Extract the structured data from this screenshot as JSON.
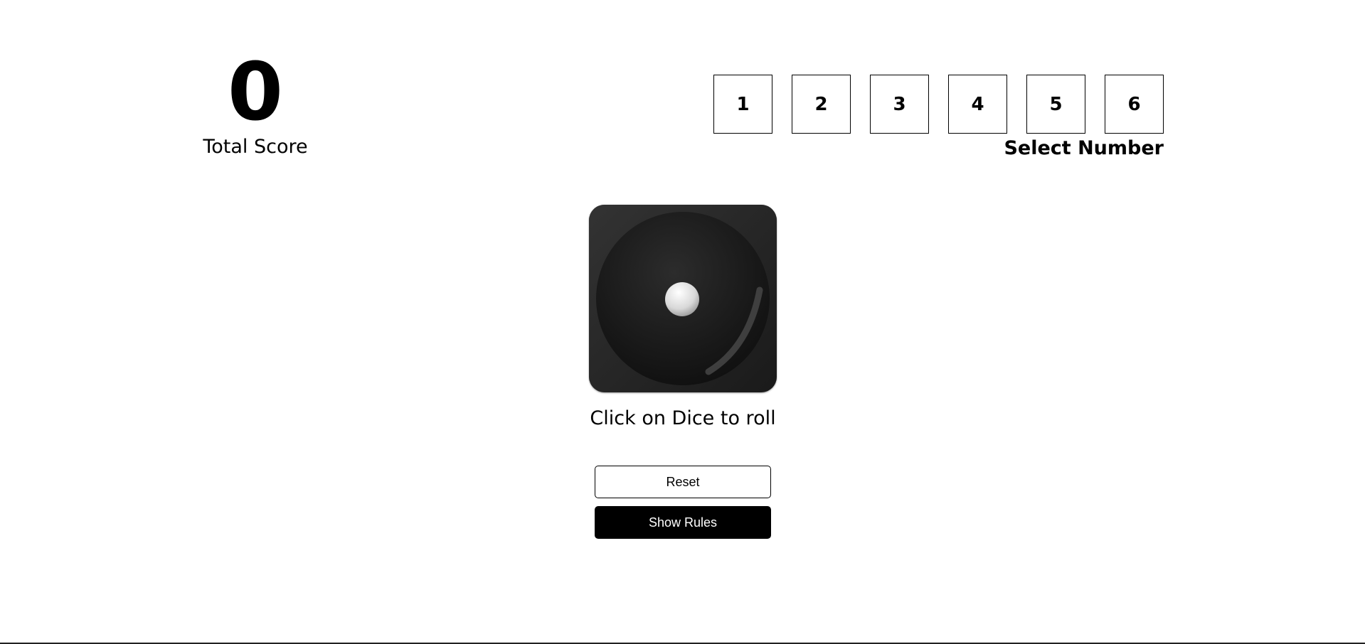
{
  "score": {
    "value": "0",
    "label": "Total Score"
  },
  "selector": {
    "numbers": [
      "1",
      "2",
      "3",
      "4",
      "5",
      "6"
    ],
    "label": "Select Number"
  },
  "dice": {
    "face": 1,
    "icon": "dice-face-one-icon",
    "instruction": "Click on Dice to roll"
  },
  "buttons": {
    "reset_label": "Reset",
    "rules_label": "Show Rules"
  },
  "colors": {
    "primary": "#000000",
    "background": "#ffffff"
  }
}
